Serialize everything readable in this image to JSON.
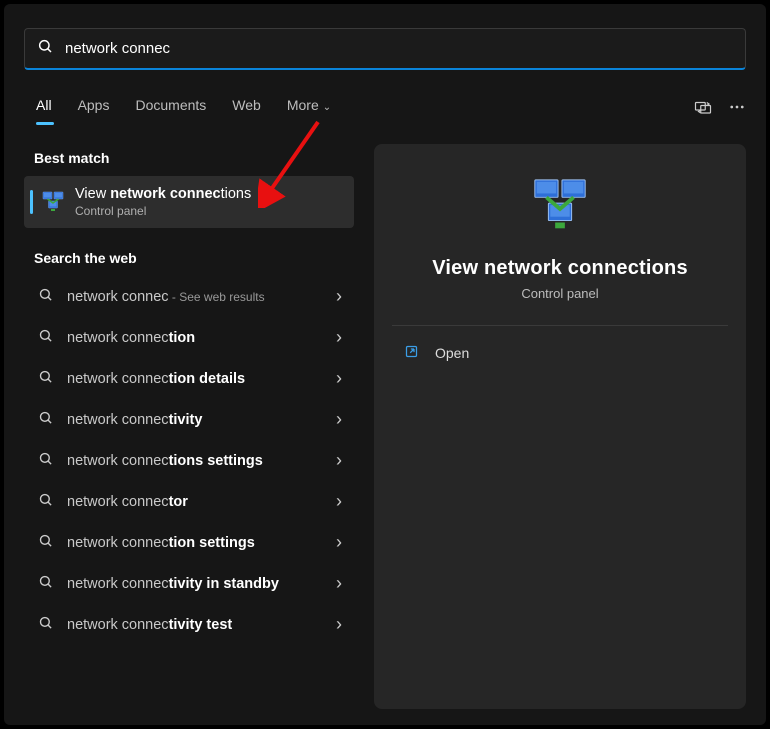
{
  "search": {
    "query": "network connec"
  },
  "tabs": {
    "items": [
      "All",
      "Apps",
      "Documents",
      "Web",
      "More"
    ],
    "active_index": 0
  },
  "sections": {
    "best_match_label": "Best match",
    "web_label": "Search the web"
  },
  "best_match": {
    "prefix": "View ",
    "bold": "network connec",
    "suffix": "tions",
    "subtitle": "Control panel"
  },
  "web_results": [
    {
      "prefix": "network connec",
      "bold": "",
      "suffix": "",
      "hint": " - See web results"
    },
    {
      "prefix": "network connec",
      "bold": "tion",
      "suffix": "",
      "hint": ""
    },
    {
      "prefix": "network connec",
      "bold": "tion details",
      "suffix": "",
      "hint": ""
    },
    {
      "prefix": "network connec",
      "bold": "tivity",
      "suffix": "",
      "hint": ""
    },
    {
      "prefix": "network connec",
      "bold": "tions settings",
      "suffix": "",
      "hint": ""
    },
    {
      "prefix": "network connec",
      "bold": "tor",
      "suffix": "",
      "hint": ""
    },
    {
      "prefix": "network connec",
      "bold": "tion settings",
      "suffix": "",
      "hint": ""
    },
    {
      "prefix": "network connec",
      "bold": "tivity in standby",
      "suffix": "",
      "hint": ""
    },
    {
      "prefix": "network connec",
      "bold": "tivity test",
      "suffix": "",
      "hint": ""
    }
  ],
  "preview": {
    "title": "View network connections",
    "subtitle": "Control panel",
    "action_open": "Open"
  }
}
